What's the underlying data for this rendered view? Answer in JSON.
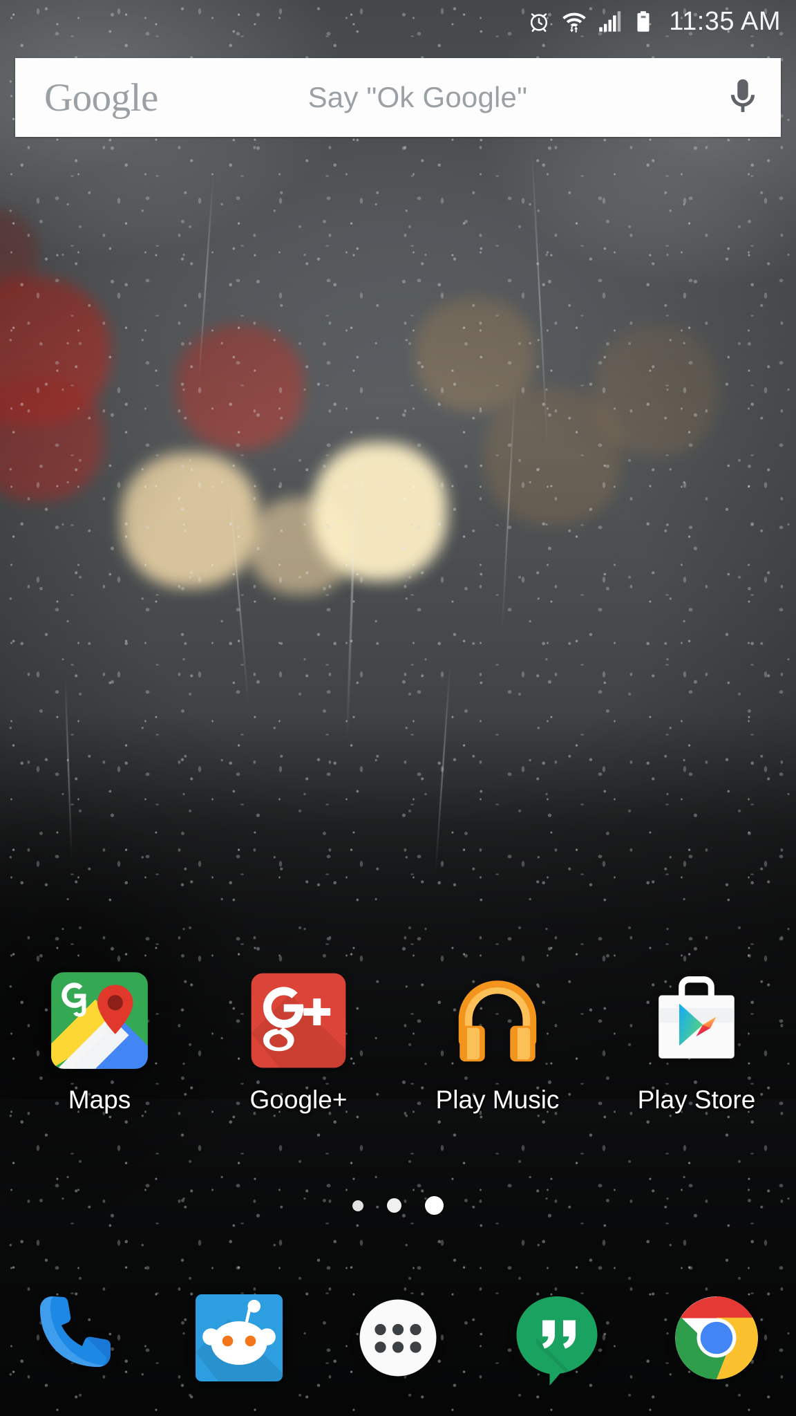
{
  "status_bar": {
    "time": "11:35 AM",
    "icons": [
      {
        "name": "alarm-icon",
        "label": "Alarm set"
      },
      {
        "name": "wifi-icon",
        "label": "Wi-Fi connected with data transfer"
      },
      {
        "name": "cellular-signal-icon",
        "label": "Cellular signal full bars"
      },
      {
        "name": "battery-icon",
        "label": "Battery"
      }
    ]
  },
  "search": {
    "logo_text": "Google",
    "placeholder": "Say \"Ok Google\"",
    "mic_icon": "microphone-icon"
  },
  "app_grid": {
    "apps": [
      {
        "label": "Maps",
        "icon": "google-maps-icon"
      },
      {
        "label": "Google+",
        "icon": "google-plus-icon"
      },
      {
        "label": "Play Music",
        "icon": "google-play-music-icon"
      },
      {
        "label": "Play Store",
        "icon": "google-play-store-icon"
      }
    ]
  },
  "page_indicator": {
    "pages": 3,
    "active_index": 2,
    "dots": [
      {
        "size": "sz-s"
      },
      {
        "size": "sz-m"
      },
      {
        "size": "sz-l"
      }
    ]
  },
  "dock": {
    "items": [
      {
        "label": "Phone",
        "icon": "phone-icon"
      },
      {
        "label": "Reddit",
        "icon": "reddit-icon"
      },
      {
        "label": "Apps",
        "icon": "app-drawer-icon"
      },
      {
        "label": "Hangouts",
        "icon": "hangouts-icon"
      },
      {
        "label": "Chrome",
        "icon": "chrome-icon"
      }
    ]
  },
  "colors": {
    "google_grey": "#9aa0a4",
    "maps_green": "#34a853",
    "maps_pin_red": "#e0392b",
    "gplus_red": "#db4437",
    "play_music_orange": "#f3941d",
    "reddit_blue": "#2d9ee0",
    "hangouts_green": "#1aa260",
    "chrome_blue": "#4285f4",
    "phone_blue": "#1e88e5"
  }
}
